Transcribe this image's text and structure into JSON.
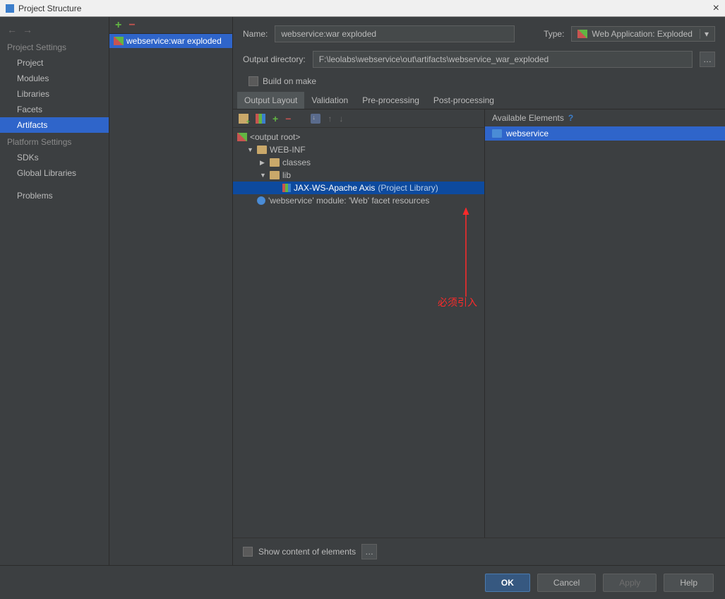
{
  "window": {
    "title": "Project Structure"
  },
  "sidebar": {
    "section1": "Project Settings",
    "section2": "Platform Settings",
    "items": {
      "project": "Project",
      "modules": "Modules",
      "libraries": "Libraries",
      "facets": "Facets",
      "artifacts": "Artifacts",
      "sdks": "SDKs",
      "global_libs": "Global Libraries",
      "problems": "Problems"
    }
  },
  "midlist": {
    "item0": "webservice:war exploded"
  },
  "form": {
    "name_label": "Name:",
    "name_value": "webservice:war exploded",
    "type_label": "Type:",
    "type_value": "Web Application: Exploded",
    "outdir_label": "Output directory:",
    "outdir_value": "F:\\leolabs\\webservice\\out\\artifacts\\webservice_war_exploded",
    "build_on_make": "Build on make"
  },
  "tabs": {
    "t0": "Output Layout",
    "t1": "Validation",
    "t2": "Pre-processing",
    "t3": "Post-processing"
  },
  "tree": {
    "root": "<output root>",
    "webinf": "WEB-INF",
    "classes": "classes",
    "lib": "lib",
    "jaxws": "JAX-WS-Apache Axis",
    "jaxws_hint": "(Project Library)",
    "facet": "'webservice' module: 'Web' facet resources"
  },
  "available": {
    "header": "Available Elements",
    "item0": "webservice"
  },
  "bottom": {
    "show_content": "Show content of elements"
  },
  "buttons": {
    "ok": "OK",
    "cancel": "Cancel",
    "apply": "Apply",
    "help": "Help"
  },
  "annotation": "必须引入"
}
